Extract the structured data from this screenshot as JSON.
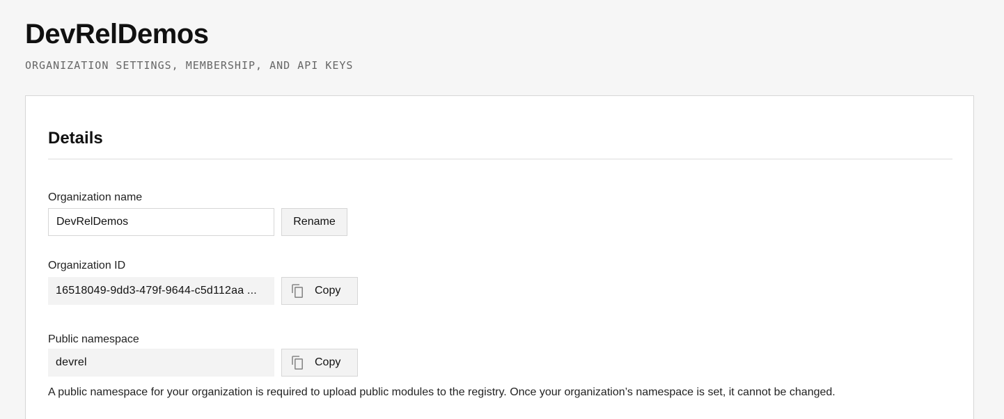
{
  "header": {
    "title": "DevRelDemos",
    "subtitle": "ORGANIZATION SETTINGS, MEMBERSHIP, AND API KEYS"
  },
  "details": {
    "title": "Details",
    "org_name": {
      "label": "Organization name",
      "value": "DevRelDemos",
      "button_label": "Rename"
    },
    "org_id": {
      "label": "Organization ID",
      "value": "16518049-9dd3-479f-9644-c5d112aa ...",
      "button_label": "Copy",
      "icon": "copy-icon"
    },
    "namespace": {
      "label": "Public namespace",
      "value": "devrel",
      "button_label": "Copy",
      "icon": "copy-icon",
      "help": "A public namespace for your organization is required to upload public modules to the registry. Once your organization’s namespace is set, it cannot be changed."
    }
  }
}
